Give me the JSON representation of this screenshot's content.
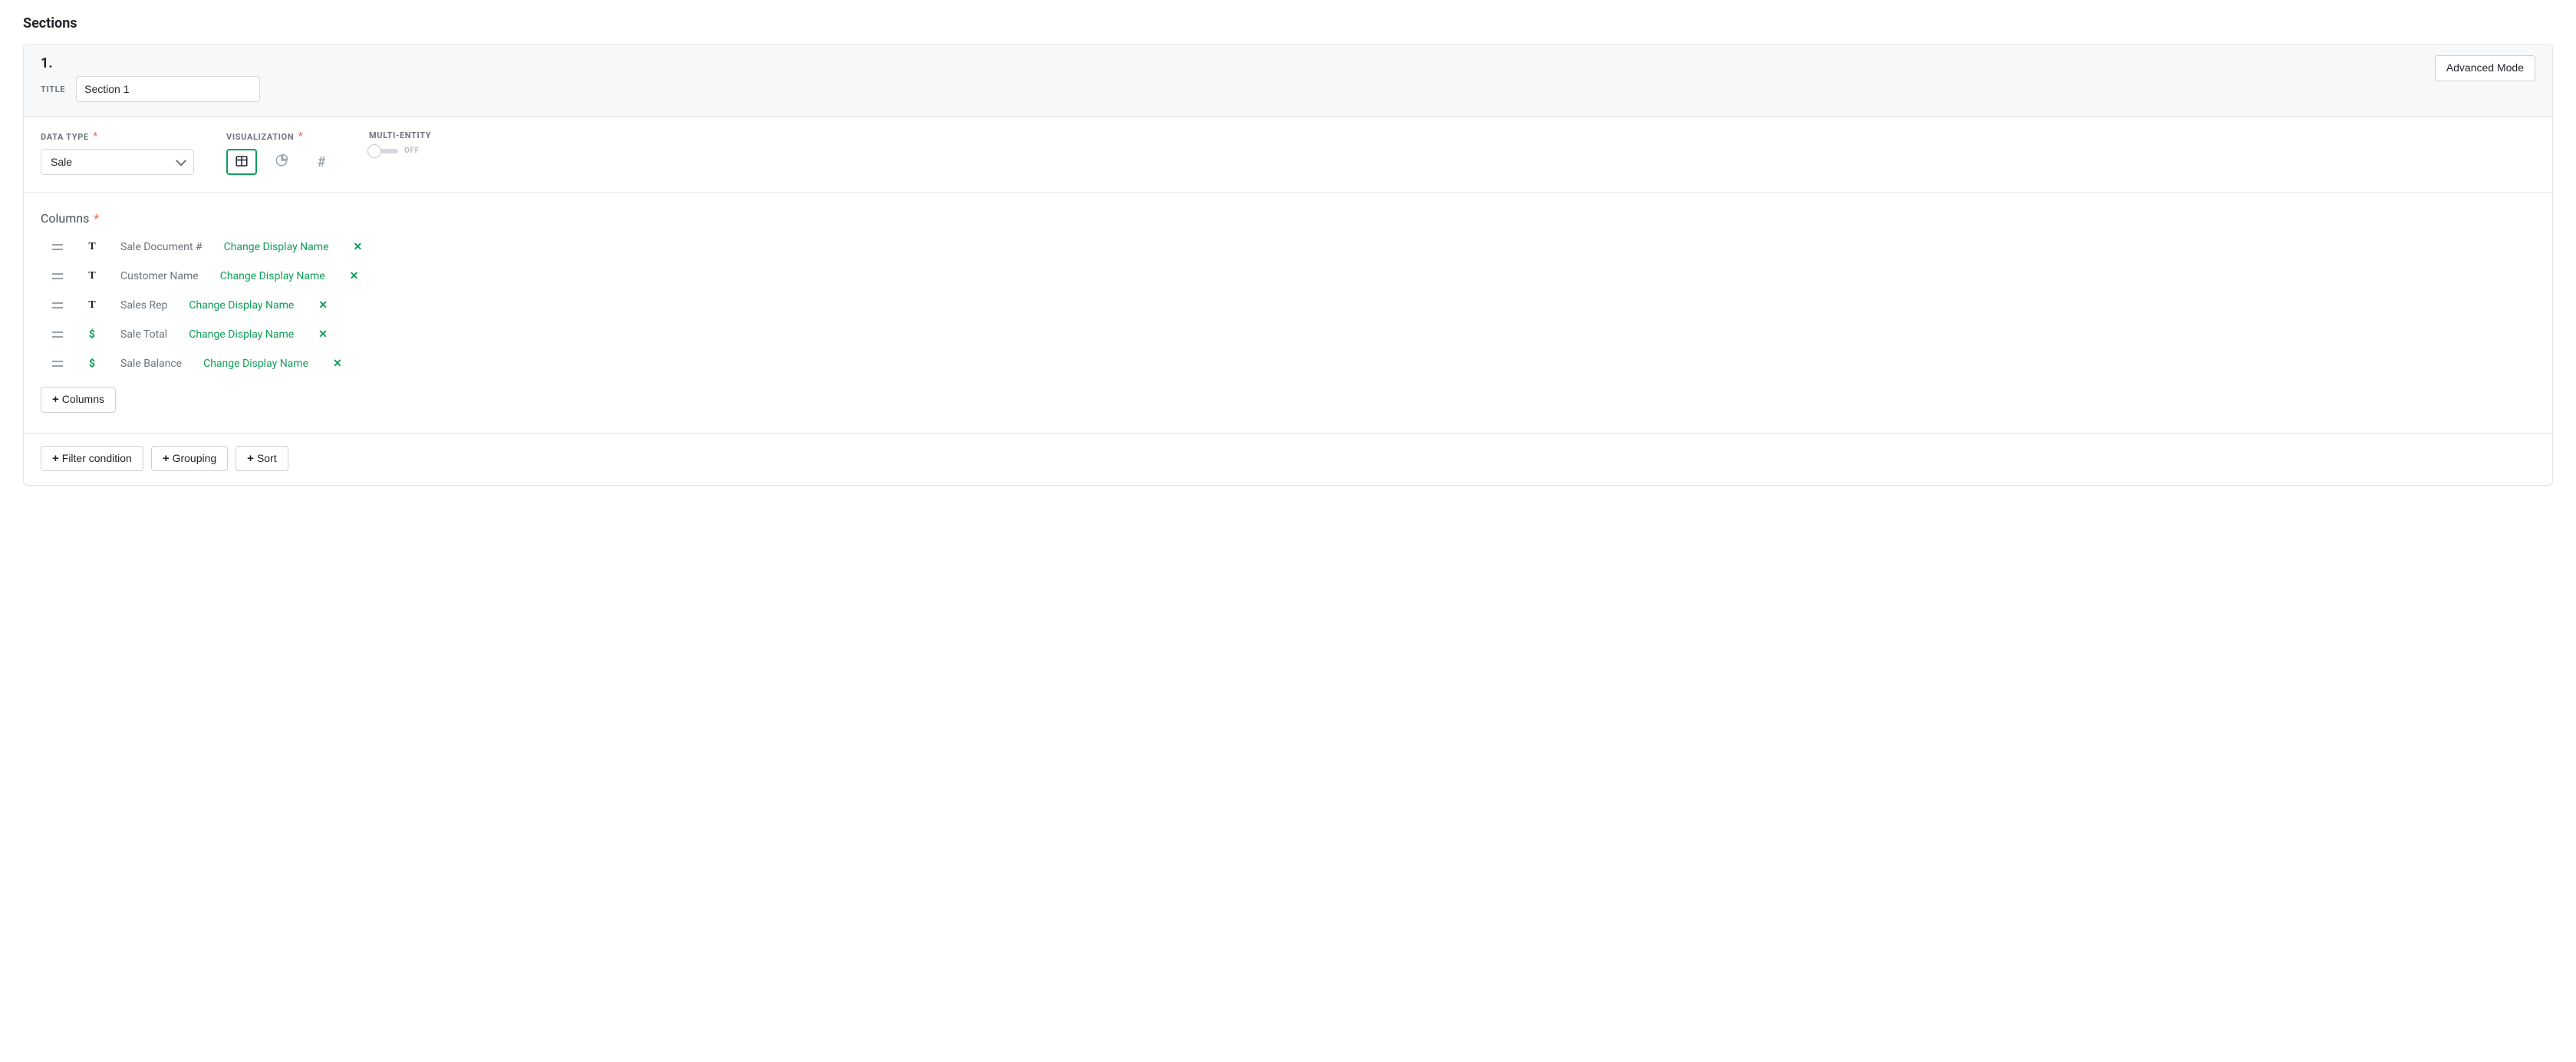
{
  "page": {
    "title": "Sections"
  },
  "section": {
    "number": "1.",
    "title_label": "TITLE",
    "title_value": "Section 1",
    "advanced_mode": "Advanced Mode"
  },
  "config": {
    "datatype_label": "DATA TYPE",
    "datatype_value": "Sale",
    "viz_label": "VISUALIZATION",
    "multi_label": "MULTI-ENTITY",
    "toggle_state": "OFF"
  },
  "columns_section": {
    "heading": "Columns",
    "change_label": "Change Display Name",
    "add_btn": "Columns"
  },
  "columns": [
    {
      "name": "Sale Document #",
      "type": "text"
    },
    {
      "name": "Customer Name",
      "type": "text"
    },
    {
      "name": "Sales Rep",
      "type": "text"
    },
    {
      "name": "Sale Total",
      "type": "currency"
    },
    {
      "name": "Sale Balance",
      "type": "currency"
    }
  ],
  "footer": {
    "filter": "Filter condition",
    "grouping": "Grouping",
    "sort": "Sort"
  }
}
